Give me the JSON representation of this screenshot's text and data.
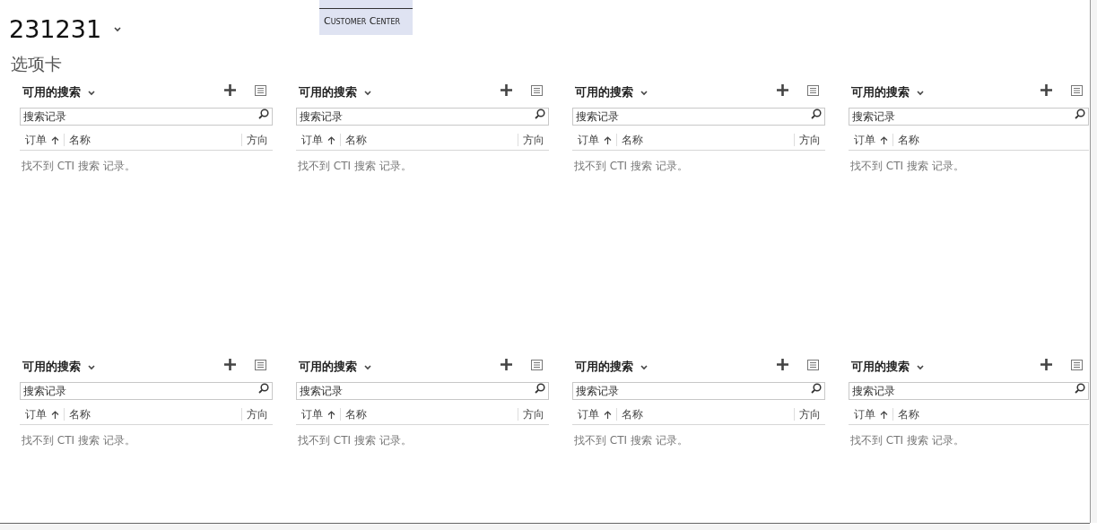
{
  "record": {
    "title": "231231"
  },
  "menu": {
    "items": [
      {
        "label": "Customer Center"
      }
    ]
  },
  "section": {
    "title": "选项卡"
  },
  "panels": [
    {
      "title": "可用的搜索",
      "search": {
        "placeholder": "搜索记录"
      },
      "columns": [
        {
          "label": "订单",
          "sorted": true
        },
        {
          "label": "名称",
          "sorted": false
        },
        {
          "label": "方向",
          "sorted": false
        }
      ],
      "empty": "找不到 CTI 搜索 记录。"
    },
    {
      "title": "可用的搜索",
      "search": {
        "placeholder": "搜索记录"
      },
      "columns": [
        {
          "label": "订单",
          "sorted": true
        },
        {
          "label": "名称",
          "sorted": false
        },
        {
          "label": "方向",
          "sorted": false
        }
      ],
      "empty": "找不到 CTI 搜索 记录。"
    },
    {
      "title": "可用的搜索",
      "search": {
        "placeholder": "搜索记录"
      },
      "columns": [
        {
          "label": "订单",
          "sorted": true
        },
        {
          "label": "名称",
          "sorted": false
        },
        {
          "label": "方向",
          "sorted": false
        }
      ],
      "empty": "找不到 CTI 搜索 记录。"
    },
    {
      "title": "可用的搜索",
      "search": {
        "placeholder": "搜索记录"
      },
      "columns": [
        {
          "label": "订单",
          "sorted": true
        },
        {
          "label": "名称",
          "sorted": false
        }
      ],
      "empty": "找不到 CTI 搜索 记录。"
    },
    {
      "title": "可用的搜索",
      "search": {
        "placeholder": "搜索记录"
      },
      "columns": [
        {
          "label": "订单",
          "sorted": true
        },
        {
          "label": "名称",
          "sorted": false
        },
        {
          "label": "方向",
          "sorted": false
        }
      ],
      "empty": "找不到 CTI 搜索 记录。"
    },
    {
      "title": "可用的搜索",
      "search": {
        "placeholder": "搜索记录"
      },
      "columns": [
        {
          "label": "订单",
          "sorted": true
        },
        {
          "label": "名称",
          "sorted": false
        },
        {
          "label": "方向",
          "sorted": false
        }
      ],
      "empty": "找不到 CTI 搜索 记录。"
    },
    {
      "title": "可用的搜索",
      "search": {
        "placeholder": "搜索记录"
      },
      "columns": [
        {
          "label": "订单",
          "sorted": true
        },
        {
          "label": "名称",
          "sorted": false
        },
        {
          "label": "方向",
          "sorted": false
        }
      ],
      "empty": "找不到 CTI 搜索 记录。"
    },
    {
      "title": "可用的搜索",
      "search": {
        "placeholder": "搜索记录"
      },
      "columns": [
        {
          "label": "订单",
          "sorted": true
        },
        {
          "label": "名称",
          "sorted": false
        }
      ],
      "empty": "找不到 CTI 搜索 记录。"
    }
  ]
}
